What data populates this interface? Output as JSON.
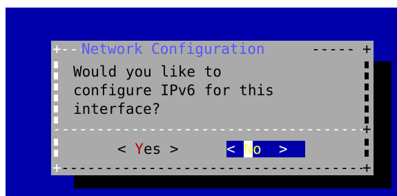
{
  "dialog": {
    "title": "Network Configuration",
    "lines": [
      "Would you like to",
      "configure IPv6 for this",
      "interface?"
    ],
    "buttons": {
      "yes": {
        "open": "< ",
        "hotkey": "Y",
        "rest": "es",
        "close": " >"
      },
      "no": {
        "open": "< ",
        "hotkey": "N",
        "rest": "o",
        "close": "  >",
        "selected": true
      }
    }
  },
  "colors": {
    "background": "#0000aa",
    "dialog": "#aaaaaa",
    "title": "#5555ff",
    "shadow": "#000000",
    "hotkey_yes": "#aa0000",
    "hotkey_no": "#ffff55"
  }
}
